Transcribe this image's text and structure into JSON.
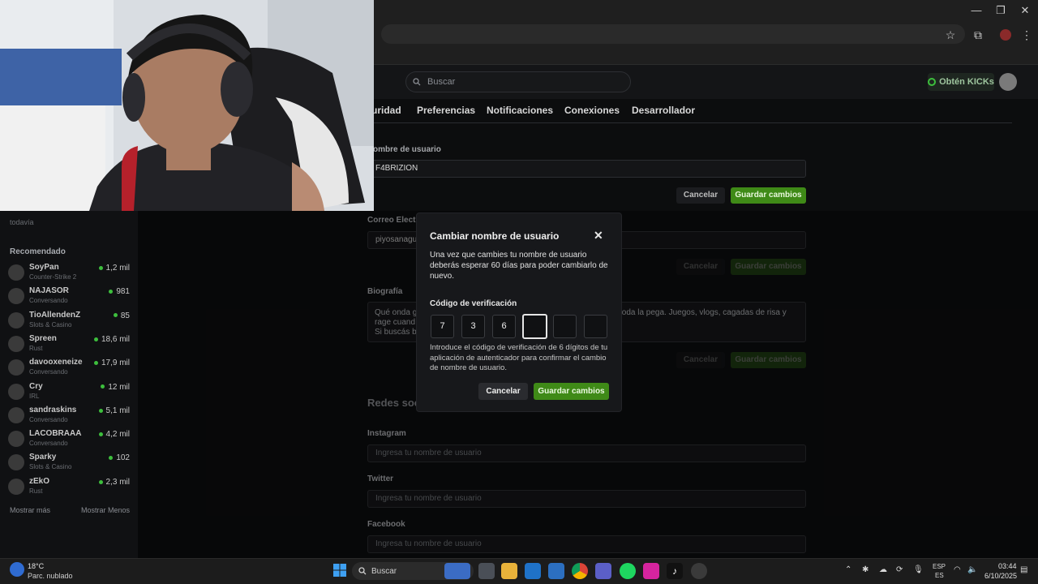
{
  "browser": {
    "window_controls": {
      "minimize": "—",
      "maximize": "❐",
      "close": "✕"
    },
    "toolbar_icons": [
      "star-icon",
      "extensions-icon",
      "profile-icon",
      "menu-icon"
    ]
  },
  "kick": {
    "search_placeholder": "Buscar",
    "kicks_button": "Obtén KICKs",
    "tabs": [
      "uridad",
      "Preferencias",
      "Notificaciones",
      "Conexiones",
      "Desarrollador"
    ],
    "username_label": "ombre de usuario",
    "username_value": "F4BRIZION",
    "cancel_label": "Cancelar",
    "save_label": "Guardar cambios",
    "email_label": "Correo Electr",
    "email_value": "piyosanagu",
    "bio_label": "Biografía",
    "bio_lines": [
      "Qué onda g",
      "rage cuand",
      "Si buscás b"
    ],
    "bio_right": "toda la pega. Juegos, vlogs, cagadas de risa y",
    "social_title": "Redes soc",
    "instagram_label": "Instagram",
    "instagram_placeholder": "Ingresa tu nombre de usuario",
    "twitter_label": "Twitter",
    "twitter_placeholder": "Ingresa tu nombre de usuario",
    "facebook_label": "Facebook",
    "facebook_placeholder": "Ingresa tu nombre de usuario"
  },
  "sidebar": {
    "partial_text": "todavía",
    "section_title": "Recomendado",
    "channels": [
      {
        "name": "SoyPan",
        "category": "Counter-Strike 2",
        "viewers": "1,2 mil"
      },
      {
        "name": "NAJASOR",
        "category": "Conversando",
        "viewers": "981"
      },
      {
        "name": "TioAllendenZ",
        "category": "Slots & Casino",
        "viewers": "85"
      },
      {
        "name": "Spreen",
        "category": "Rust",
        "viewers": "18,6 mil"
      },
      {
        "name": "davooxeneize",
        "category": "Conversando",
        "viewers": "17,9 mil"
      },
      {
        "name": "Cry",
        "category": "IRL",
        "viewers": "12 mil"
      },
      {
        "name": "sandraskins",
        "category": "Conversando",
        "viewers": "5,1 mil"
      },
      {
        "name": "LACOBRAAA",
        "category": "Conversando",
        "viewers": "4,2 mil"
      },
      {
        "name": "Sparky",
        "category": "Slots & Casino",
        "viewers": "102"
      },
      {
        "name": "zEkO",
        "category": "Rust",
        "viewers": "2,3 mil"
      }
    ],
    "show_more": "Mostrar más",
    "show_less": "Mostrar Menos"
  },
  "modal": {
    "title": "Cambiar nombre de usuario",
    "close": "✕",
    "description": "Una vez que cambies tu nombre de usuario deberás esperar 60 días para poder cambiarlo de nuevo.",
    "code_label": "Código de verificación",
    "code_digits": [
      "7",
      "3",
      "6",
      "",
      "",
      ""
    ],
    "help": "Introduce el código de verificación de 6 dígitos de tu aplicación de autenticador para confirmar el cambio de nombre de usuario.",
    "cancel": "Cancelar",
    "save": "Guardar cambios"
  },
  "taskbar": {
    "weather_temp": "18°C",
    "weather_desc": "Parc. nublado",
    "search": "Buscar",
    "lang_top": "ESP",
    "lang_bottom": "ES",
    "time": "03:44",
    "date": "6/10/2025"
  },
  "colors": {
    "accent_green": "#3f8a17",
    "live_dot": "#3dbf3d"
  }
}
